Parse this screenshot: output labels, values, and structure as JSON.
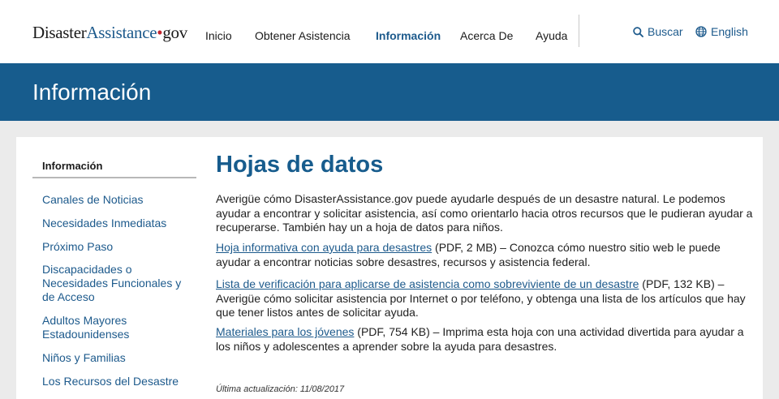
{
  "header": {
    "logo": {
      "part1": "Disaster",
      "part2": "Assistance",
      "dot": "•",
      "part3": "gov"
    },
    "nav": [
      "Inicio",
      "Obtener Asistencia",
      "Información",
      "Acerca De",
      "Ayuda"
    ],
    "search_label": "Buscar",
    "language_label": "English"
  },
  "banner": {
    "title": "Información"
  },
  "sidebar": {
    "title": "Información",
    "items": [
      "Canales de Noticias",
      "Necesidades Inmediatas",
      "Próximo Paso",
      "Discapacidades o Necesidades Funcionales y de Acceso",
      "Adultos Mayores Estadounidenses",
      "Niños y Familias",
      "Los Recursos del Desastre"
    ]
  },
  "main": {
    "title": "Hojas de datos",
    "intro": "Averigüe cómo DisasterAssistance.gov puede ayudarle después de un desastre natural. Le podemos ayudar a encontrar y solicitar asistencia, así como orientarlo hacia otros recursos que le pudieran ayudar a recuperarse. También hay un a hoja de datos para niños.",
    "docs": [
      {
        "link": "Hoja informativa con ayuda para desastres",
        "text": " (PDF, 2 MB) – Conozca cómo nuestro sitio web le puede ayudar a encontrar noticias sobre desastres, recursos y asistencia federal."
      },
      {
        "link": "Lista de verificación para aplicarse de asistencia como sobreviviente de un desastre",
        "text": " (PDF, 132 KB) – Averigüe cómo solicitar asistencia por Internet o por teléfono, y obtenga una lista de los artículos que hay que tener listos antes de solicitar ayuda."
      },
      {
        "link": "Materiales para los jóvenes",
        "text": " (PDF, 754 KB) – Imprima esta hoja con una actividad divertida para ayudar a los niños y adolescentes a aprender sobre la ayuda para desastres."
      }
    ],
    "updated": "Última actualización: 11/08/2017"
  }
}
